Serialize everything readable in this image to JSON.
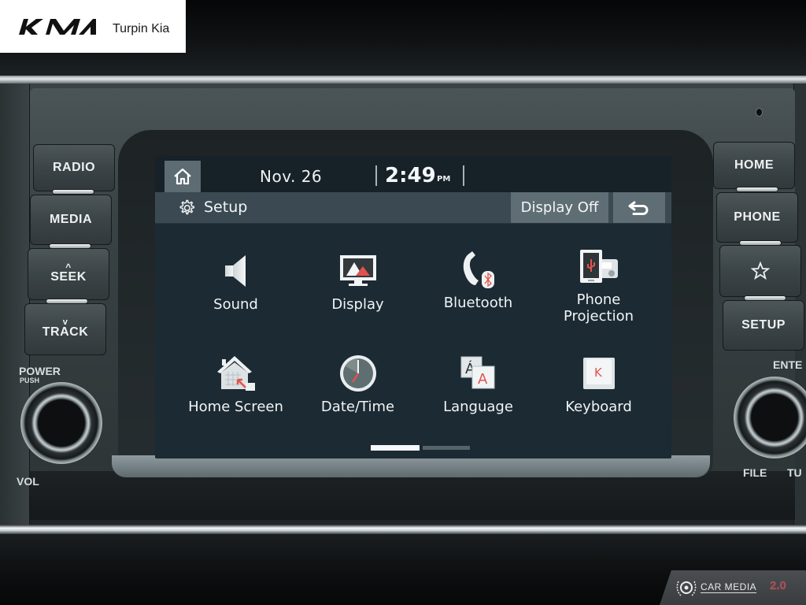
{
  "overlay": {
    "dealer_logo": "KIA",
    "dealer_name": "Turpin Kia",
    "watermark_text": "CAR MEDIA",
    "watermark_version": "2.0"
  },
  "statusbar": {
    "home_icon": "home-icon",
    "date": "Nov. 26",
    "time": "2:49",
    "ampm": "PM"
  },
  "titlebar": {
    "icon": "gear-icon",
    "title": "Setup",
    "display_off_label": "Display Off",
    "back_icon": "back-arrow-icon"
  },
  "menu": {
    "items": [
      {
        "label": "Sound",
        "icon": "speaker-icon"
      },
      {
        "label": "Display",
        "icon": "monitor-icon"
      },
      {
        "label": "Bluetooth",
        "icon": "bluetooth-phone-icon"
      },
      {
        "label": "Phone\nProjection",
        "label_line1": "Phone",
        "label_line2": "Projection",
        "icon": "phone-projection-icon"
      },
      {
        "label": "Home Screen",
        "icon": "home-screen-icon"
      },
      {
        "label": "Date/Time",
        "icon": "clock-icon"
      },
      {
        "label": "Language",
        "icon": "language-icon"
      },
      {
        "label": "Keyboard",
        "icon": "keyboard-icon"
      }
    ]
  },
  "pager": {
    "total_pages": 2,
    "current_page": 1
  },
  "left_buttons": [
    {
      "label": "RADIO"
    },
    {
      "label": "MEDIA"
    },
    {
      "label": "SEEK",
      "accent": "^"
    },
    {
      "label": "TRACK",
      "accent": "v"
    }
  ],
  "right_buttons": [
    {
      "label": "HOME"
    },
    {
      "label": "PHONE"
    },
    {
      "label": "",
      "icon": "star-icon"
    },
    {
      "label": "SETUP"
    }
  ],
  "left_knob": {
    "top_label": "POWER",
    "sub_label": "PUSH",
    "bottom_label": "VOL"
  },
  "right_knob": {
    "top_label": "ENTE",
    "bottom_left_label": "FILE",
    "bottom_right_label": "TU"
  },
  "colors": {
    "screen_bg": "#1b2a33",
    "titlebar_bg": "#3b4a52",
    "button_bg": "#5f6d74",
    "icon_accent_red": "#e0544e"
  }
}
